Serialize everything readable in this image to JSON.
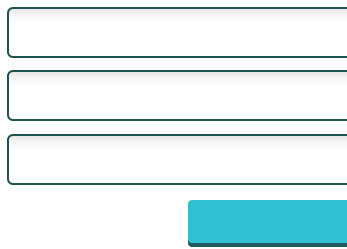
{
  "form": {
    "fields": [
      {
        "value": "",
        "placeholder": ""
      },
      {
        "value": "",
        "placeholder": ""
      },
      {
        "value": "",
        "placeholder": ""
      }
    ],
    "submit_label": ""
  },
  "colors": {
    "field_border": "#1e5352",
    "button_background": "#2fc0d2",
    "button_shadow": "#1f5b63"
  }
}
